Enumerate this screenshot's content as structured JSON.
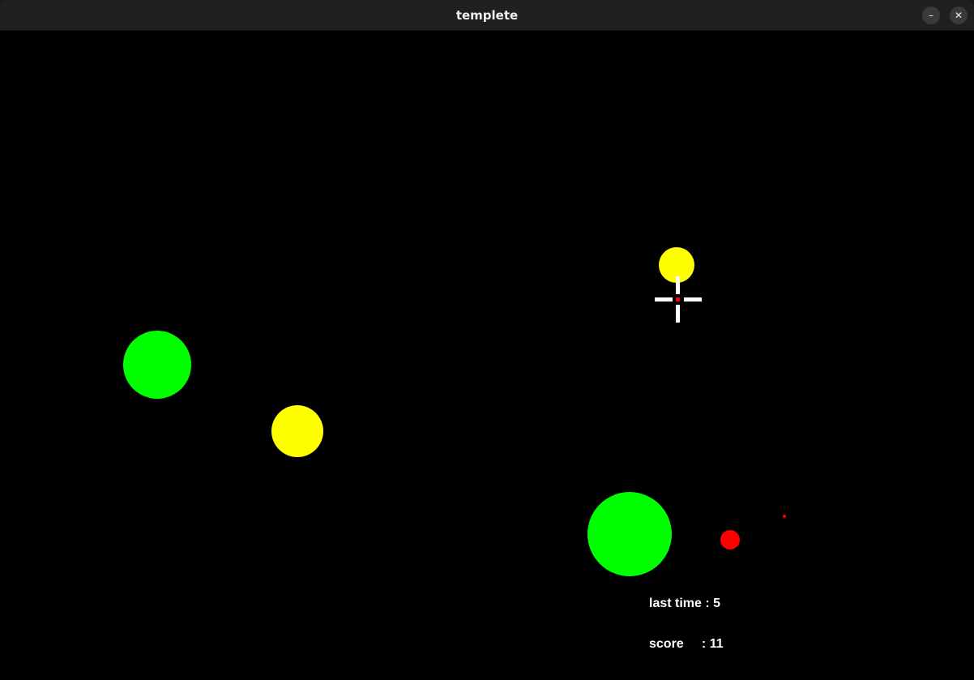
{
  "window": {
    "title": "templete",
    "minimize_icon": "minimize-icon",
    "close_icon": "close-icon"
  },
  "hud": {
    "time_label": "last time",
    "time_sep": " : ",
    "time_value": "5",
    "score_label": "score",
    "score_sep": "     : ",
    "score_value": "11"
  },
  "colors": {
    "background": "#000000",
    "green_target": "#00ff00",
    "yellow_target": "#ffff00",
    "red_target": "#ff0000",
    "crosshair": "#ffffff",
    "crosshair_center": "#ff0000",
    "hud_text": "#ffffff"
  }
}
